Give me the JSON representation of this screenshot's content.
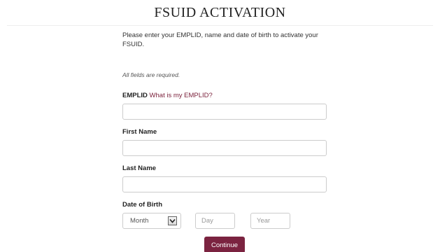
{
  "page": {
    "title": "FSUID ACTIVATION"
  },
  "form": {
    "intro": "Please enter your EMPLID, name and date of birth to activate your FSUID.",
    "required_note": "All fields are required.",
    "emplid": {
      "label": "EMPLID",
      "help_link": "What is my EMPLID?",
      "value": ""
    },
    "first_name": {
      "label": "First Name",
      "value": ""
    },
    "last_name": {
      "label": "Last Name",
      "value": ""
    },
    "dob": {
      "label": "Date of Birth",
      "month_selected": "Month",
      "day_placeholder": "Day",
      "year_placeholder": "Year"
    },
    "continue_label": "Continue"
  },
  "colors": {
    "accent": "#7b2340",
    "link": "#7a1f3a"
  },
  "icons": {
    "month_dropdown": "chevron-down-icon"
  }
}
